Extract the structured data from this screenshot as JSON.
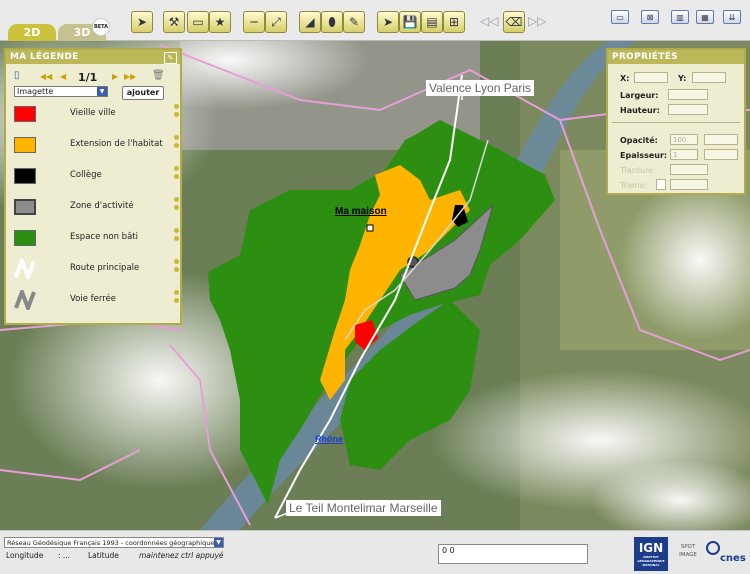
{
  "tabs": {
    "tab_2d": "2D",
    "tab_3d": "3D",
    "beta_badge": "BETA"
  },
  "legend": {
    "title": "MA LÉGENDE",
    "pager": "1/1",
    "layer_select": "Imagette",
    "add_button": "ajouter",
    "items": [
      {
        "label": "Vieille ville",
        "color": "#ff0000"
      },
      {
        "label": "Extension de l'habitat",
        "color": "#ffb400"
      },
      {
        "label": "Collège",
        "color": "#000000"
      },
      {
        "label": "Zone d'activité",
        "color": "#8c8c8c"
      },
      {
        "label": "Espace non bâti",
        "color": "#2d8f12"
      },
      {
        "label": "Route principale",
        "color": "#ffffff"
      },
      {
        "label": "Voie ferrée",
        "color": "#888888"
      }
    ]
  },
  "properties": {
    "title": "PROPRIÉTÉS",
    "x_label": "X:",
    "y_label": "Y:",
    "width_label": "Largeur:",
    "height_label": "Hauteur:",
    "opacity_label": "Opacité:",
    "opacity_value": "100",
    "thickness_label": "Epaisseur:",
    "thickness_value": "1",
    "shading_label": "Tiardure:",
    "frame_label": "Trame:"
  },
  "map": {
    "label_north": "Valence Lyon Paris",
    "label_south": "Le Teil Montelimar Marseille",
    "label_house": "Ma maison",
    "label_river": "Rhône"
  },
  "status": {
    "projection": "Réseau Géodésique Français 1993 - coordonnées géographiques",
    "longitude_label": "Longitude",
    "longitude_value": ": ...",
    "latitude_label": "Latitude",
    "hint": "maintenez ctrl appuyé",
    "coords_value": "0 0",
    "logo_ign": "IGN",
    "logo_ign_sub": "INSTITUT GÉOGRAPHIQUE NATIONAL",
    "logo_spot": "SPOT IMAGE",
    "logo_cnes": "cnes"
  },
  "colors": {
    "accent": "#bcb85a",
    "habitat": "#ffb400",
    "green": "#2d8f12"
  }
}
